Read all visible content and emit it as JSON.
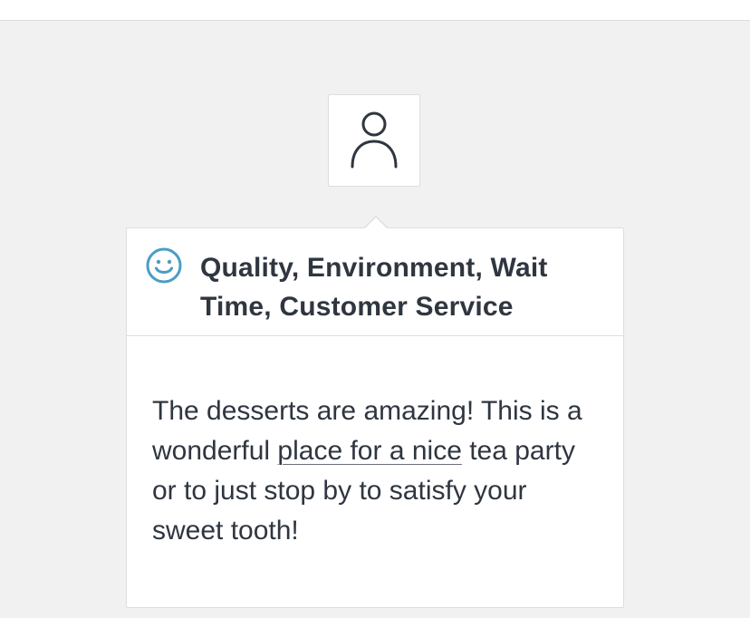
{
  "avatar": {
    "icon": "user-icon"
  },
  "review_card": {
    "sentiment_icon": "smile-icon",
    "accent_color": "#4a9ec4",
    "categories": "Quality, Environment, Wait Time, Customer Service",
    "body_before": "The desserts are amazing! This is a wonderful ",
    "body_link": "place for a nice",
    "body_after": " tea party or to just stop by to satisfy your sweet tooth!"
  }
}
